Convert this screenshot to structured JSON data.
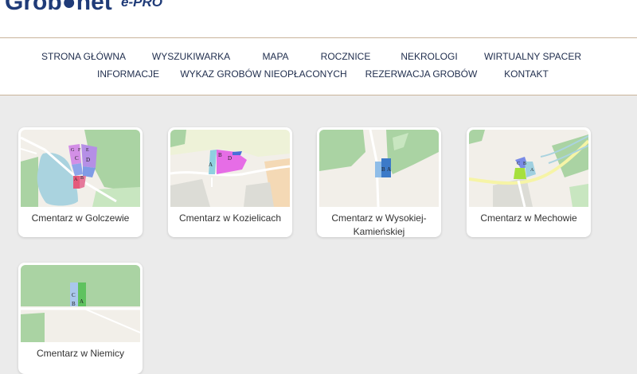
{
  "logo": {
    "main": "Grob●net",
    "sub": "e-PRO"
  },
  "nav": {
    "row1": [
      "STRONA GŁÓWNA",
      "WYSZUKIWARKA",
      "MAPA",
      "ROCZNICE",
      "NEKROLOGI",
      "WIRTUALNY SPACER"
    ],
    "row2": [
      "INFORMACJE",
      "WYKAZ GROBÓW NIEOPŁACONYCH",
      "REZERWACJA GROBÓW",
      "KONTAKT"
    ]
  },
  "cemeteries": [
    {
      "name": "Cmentarz w Golczewie",
      "sections": [
        "G",
        "F",
        "E",
        "C",
        "D",
        "A",
        "B"
      ]
    },
    {
      "name": "Cmentarz w Kozielicach",
      "sections": [
        "B",
        "D",
        "A"
      ]
    },
    {
      "name": "Cmentarz w Wysokiej-Kamieńskiej",
      "sections": [
        "B",
        "A"
      ]
    },
    {
      "name": "Cmentarz w Mechowie",
      "sections": [
        "C",
        "B",
        "A"
      ]
    },
    {
      "name": "Cmentarz w Niemicy",
      "sections": [
        "C",
        "B",
        "A"
      ]
    }
  ],
  "colors": {
    "brand": "#1f3b78",
    "border": "#c9b39a",
    "background": "#ebebeb",
    "map_land": "#f2efe9",
    "map_forest": "#aad3a3",
    "map_water": "#aad3df"
  }
}
